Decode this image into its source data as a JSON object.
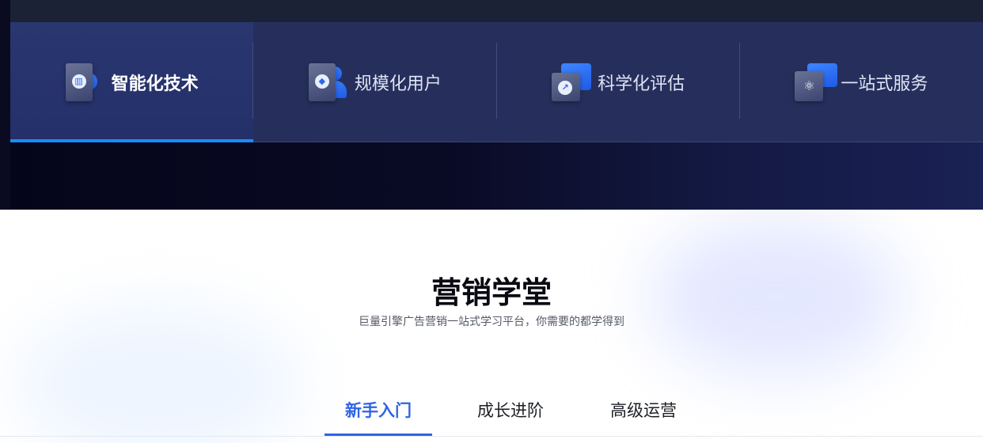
{
  "feature_bar": {
    "items": [
      {
        "label": "智能化技术",
        "icon": "chart-bar-icon",
        "active": true
      },
      {
        "label": "规模化用户",
        "icon": "cube-user-icon",
        "active": false
      },
      {
        "label": "科学化评估",
        "icon": "trend-chart-icon",
        "active": false
      },
      {
        "label": "一站式服务",
        "icon": "atom-service-icon",
        "active": false
      }
    ],
    "accent_color": "#1a8cf5"
  },
  "school": {
    "title": "营销学堂",
    "subtitle": "巨量引擎广告营销一站式学习平台，你需要的都学得到",
    "tabs": [
      {
        "label": "新手入门",
        "active": true
      },
      {
        "label": "成长进阶",
        "active": false
      },
      {
        "label": "高级运营",
        "active": false
      }
    ],
    "accent_color": "#2f64e6"
  }
}
